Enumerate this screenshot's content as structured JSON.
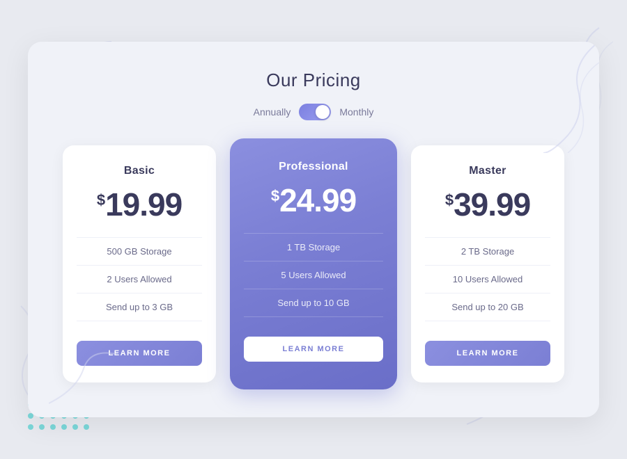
{
  "page": {
    "title": "Our Pricing",
    "toggle": {
      "left_label": "Annually",
      "right_label": "Monthly"
    }
  },
  "plans": [
    {
      "id": "basic",
      "name": "Basic",
      "dollar": "$",
      "price": "19.99",
      "features": [
        "500 GB Storage",
        "2 Users Allowed",
        "Send up to 3 GB"
      ],
      "cta": "LEARN MORE",
      "featured": false
    },
    {
      "id": "professional",
      "name": "Professional",
      "dollar": "$",
      "price": "24.99",
      "features": [
        "1 TB Storage",
        "5 Users Allowed",
        "Send up to 10 GB"
      ],
      "cta": "LEARN MORE",
      "featured": true
    },
    {
      "id": "master",
      "name": "Master",
      "dollar": "$",
      "price": "39.99",
      "features": [
        "2 TB Storage",
        "10 Users Allowed",
        "Send up to 20 GB"
      ],
      "cta": "LEARN MORE",
      "featured": false
    }
  ],
  "decorative": {
    "dots_color": "#4dcfcf"
  }
}
